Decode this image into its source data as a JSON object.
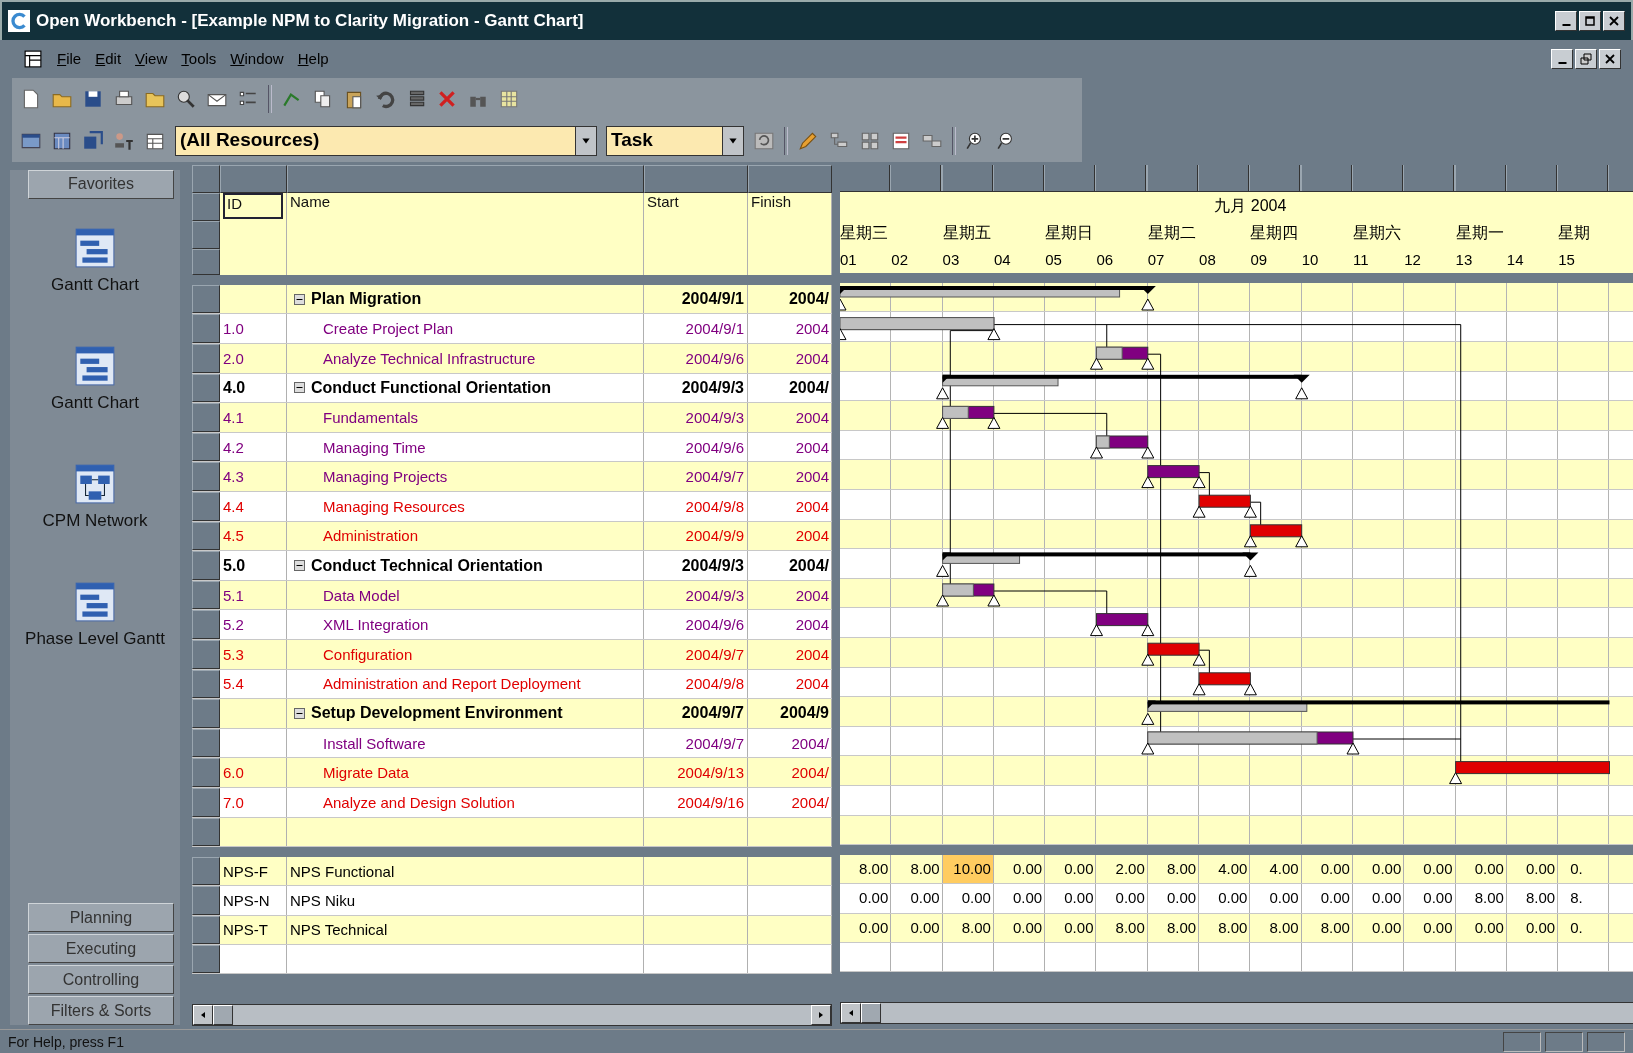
{
  "window": {
    "title": "Open Workbench - [Example NPM to Clarity Migration - Gantt Chart]"
  },
  "menu": [
    "File",
    "Edit",
    "View",
    "Tools",
    "Window",
    "Help"
  ],
  "toolbar": {
    "resource_filter": {
      "value": "(All Resources)"
    },
    "view_filter": {
      "value": "Task"
    }
  },
  "sidebar": {
    "header": "Favorites",
    "items": [
      {
        "label": "Gantt Chart",
        "kind": "gantt"
      },
      {
        "label": "Gantt Chart",
        "kind": "gantt"
      },
      {
        "label": "CPM Network",
        "kind": "network"
      },
      {
        "label": "Phase Level Gantt",
        "kind": "gantt"
      }
    ],
    "groups": [
      "Planning",
      "Executing",
      "Controlling",
      "Filters & Sorts"
    ]
  },
  "table": {
    "columns": [
      "ID",
      "Name",
      "Start",
      "Finish"
    ],
    "rows": [
      {
        "id": "",
        "name": "Plan Migration",
        "start": "2004/9/1",
        "finish": "2004/",
        "kind": "summary",
        "expanded": true,
        "critical": false
      },
      {
        "id": "1.0",
        "name": "Create Project Plan",
        "start": "2004/9/1",
        "finish": "2004",
        "kind": "task",
        "critical": false
      },
      {
        "id": "2.0",
        "name": "Analyze Technical Infrastructure",
        "start": "2004/9/6",
        "finish": "2004",
        "kind": "task",
        "critical": false
      },
      {
        "id": "4.0",
        "name": "Conduct Functional Orientation",
        "start": "2004/9/3",
        "finish": "2004/",
        "kind": "summary",
        "expanded": true,
        "critical": false
      },
      {
        "id": "4.1",
        "name": "Fundamentals",
        "start": "2004/9/3",
        "finish": "2004",
        "kind": "task",
        "critical": false
      },
      {
        "id": "4.2",
        "name": "Managing Time",
        "start": "2004/9/6",
        "finish": "2004",
        "kind": "task",
        "critical": false
      },
      {
        "id": "4.3",
        "name": "Managing Projects",
        "start": "2004/9/7",
        "finish": "2004",
        "kind": "task",
        "critical": false
      },
      {
        "id": "4.4",
        "name": "Managing Resources",
        "start": "2004/9/8",
        "finish": "2004",
        "kind": "task",
        "critical": true
      },
      {
        "id": "4.5",
        "name": "Administration",
        "start": "2004/9/9",
        "finish": "2004",
        "kind": "task",
        "critical": true
      },
      {
        "id": "5.0",
        "name": "Conduct Technical Orientation",
        "start": "2004/9/3",
        "finish": "2004/",
        "kind": "summary",
        "expanded": true,
        "critical": false
      },
      {
        "id": "5.1",
        "name": "Data Model",
        "start": "2004/9/3",
        "finish": "2004",
        "kind": "task",
        "critical": false
      },
      {
        "id": "5.2",
        "name": "XML Integration",
        "start": "2004/9/6",
        "finish": "2004",
        "kind": "task",
        "critical": false
      },
      {
        "id": "5.3",
        "name": "Configuration",
        "start": "2004/9/7",
        "finish": "2004",
        "kind": "task",
        "critical": true
      },
      {
        "id": "5.4",
        "name": "Administration and Report Deployment",
        "start": "2004/9/8",
        "finish": "2004",
        "kind": "task",
        "critical": true
      },
      {
        "id": "",
        "name": "Setup Development Environment",
        "start": "2004/9/7",
        "finish": "2004/9",
        "kind": "summary",
        "expanded": true,
        "critical": false
      },
      {
        "id": "",
        "name": "Install Software",
        "start": "2004/9/7",
        "finish": "2004/",
        "kind": "task",
        "critical": false
      },
      {
        "id": "6.0",
        "name": "Migrate Data",
        "start": "2004/9/13",
        "finish": "2004/",
        "kind": "task",
        "critical": true
      },
      {
        "id": "7.0",
        "name": "Analyze and Design Solution",
        "start": "2004/9/16",
        "finish": "2004/",
        "kind": "task",
        "critical": true
      }
    ]
  },
  "timescale": {
    "month": "九月 2004",
    "weekdays": [
      "星期三",
      "星期五",
      "星期日",
      "星期二",
      "星期四",
      "星期六",
      "星期一",
      "星期"
    ],
    "days": [
      "01",
      "02",
      "03",
      "04",
      "05",
      "06",
      "07",
      "08",
      "09",
      "10",
      "11",
      "12",
      "13",
      "14",
      "15"
    ]
  },
  "resources": {
    "rows": [
      {
        "id": "NPS-F",
        "name": "NPS Functional",
        "cells": [
          {
            "v": "8.00",
            "over": false
          },
          {
            "v": "8.00",
            "over": false
          },
          {
            "v": "10.00",
            "over": true
          },
          {
            "v": "0.00",
            "over": false
          },
          {
            "v": "0.00",
            "over": false
          },
          {
            "v": "2.00",
            "over": false
          },
          {
            "v": "8.00",
            "over": false
          },
          {
            "v": "4.00",
            "over": false
          },
          {
            "v": "4.00",
            "over": false
          },
          {
            "v": "0.00",
            "over": false
          },
          {
            "v": "0.00",
            "over": false
          },
          {
            "v": "0.00",
            "over": false
          },
          {
            "v": "0.00",
            "over": false
          },
          {
            "v": "0.00",
            "over": false
          },
          {
            "v": "0.",
            "over": false
          }
        ]
      },
      {
        "id": "NPS-N",
        "name": "NPS Niku",
        "cells": [
          {
            "v": "0.00",
            "over": false
          },
          {
            "v": "0.00",
            "over": false
          },
          {
            "v": "0.00",
            "over": false
          },
          {
            "v": "0.00",
            "over": false
          },
          {
            "v": "0.00",
            "over": false
          },
          {
            "v": "0.00",
            "over": false
          },
          {
            "v": "0.00",
            "over": false
          },
          {
            "v": "0.00",
            "over": false
          },
          {
            "v": "0.00",
            "over": false
          },
          {
            "v": "0.00",
            "over": false
          },
          {
            "v": "0.00",
            "over": false
          },
          {
            "v": "0.00",
            "over": false
          },
          {
            "v": "8.00",
            "over": false
          },
          {
            "v": "8.00",
            "over": false
          },
          {
            "v": "8.",
            "over": false
          }
        ]
      },
      {
        "id": "NPS-T",
        "name": "NPS Technical",
        "cells": [
          {
            "v": "0.00",
            "over": false
          },
          {
            "v": "0.00",
            "over": false
          },
          {
            "v": "8.00",
            "over": false
          },
          {
            "v": "0.00",
            "over": false
          },
          {
            "v": "0.00",
            "over": false
          },
          {
            "v": "8.00",
            "over": false
          },
          {
            "v": "8.00",
            "over": false
          },
          {
            "v": "8.00",
            "over": false
          },
          {
            "v": "8.00",
            "over": false
          },
          {
            "v": "8.00",
            "over": false
          },
          {
            "v": "0.00",
            "over": false
          },
          {
            "v": "0.00",
            "over": false
          },
          {
            "v": "0.00",
            "over": false
          },
          {
            "v": "0.00",
            "over": false
          },
          {
            "v": "0.",
            "over": false
          }
        ]
      }
    ]
  },
  "status_bar": {
    "text": "For Help, press F1"
  }
}
